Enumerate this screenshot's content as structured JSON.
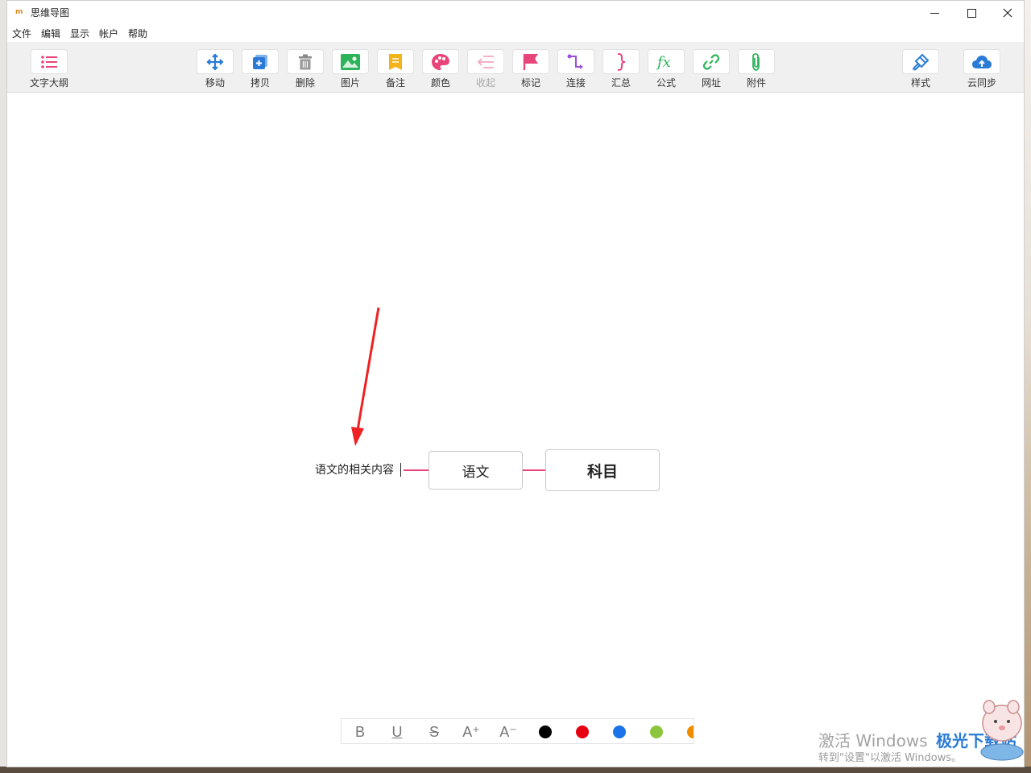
{
  "window": {
    "title": "思维导图",
    "logo_text": "m"
  },
  "menu": [
    "文件",
    "编辑",
    "显示",
    "帐户",
    "帮助"
  ],
  "toolbar": {
    "outline_label": "文字大纲",
    "tools": [
      {
        "label": "移动",
        "icon": "move-icon",
        "color": "#2a7bd6"
      },
      {
        "label": "拷贝",
        "icon": "copy-icon",
        "color": "#2a7bd6"
      },
      {
        "label": "删除",
        "icon": "trash-icon",
        "color": "#888888"
      },
      {
        "label": "图片",
        "icon": "image-icon",
        "color": "#2db35a"
      },
      {
        "label": "备注",
        "icon": "note-icon",
        "color": "#f2b418"
      },
      {
        "label": "颜色",
        "icon": "palette-icon",
        "color": "#e8457a"
      },
      {
        "label": "收起",
        "icon": "collapse-icon",
        "color": "#f2a6c0"
      },
      {
        "label": "标记",
        "icon": "flag-icon",
        "color": "#e8457a"
      },
      {
        "label": "连接",
        "icon": "connect-icon",
        "color": "#9b4fd6"
      },
      {
        "label": "汇总",
        "icon": "summary-icon",
        "color": "#e8457a"
      },
      {
        "label": "公式",
        "icon": "formula-icon",
        "color": "#2db35a"
      },
      {
        "label": "网址",
        "icon": "link-icon",
        "color": "#2db35a"
      },
      {
        "label": "附件",
        "icon": "attachment-icon",
        "color": "#2db35a"
      }
    ],
    "style_label": "样式",
    "sync_label": "云同步"
  },
  "mindmap": {
    "root": "科目",
    "child": "语文",
    "leaf": "语文的相关内容",
    "line_color": "#e8457a"
  },
  "format_bar": {
    "bold": "B",
    "underline": "U",
    "strike": "S",
    "grow": "A⁺",
    "shrink": "A⁻",
    "colors": [
      "#000000",
      "#e60012",
      "#1a73e8",
      "#8cc63f",
      "#f08c00"
    ]
  },
  "watermark": {
    "line1": "激活 Windows",
    "line2": "转到\"设置\"以激活 Windows。",
    "site": "极光下载站"
  }
}
